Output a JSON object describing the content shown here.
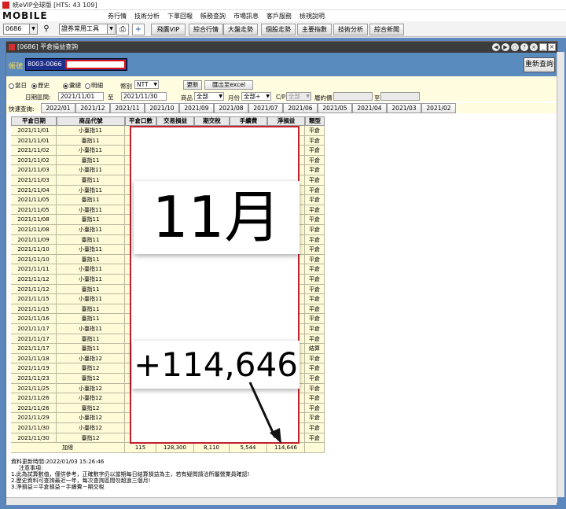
{
  "titlebar": {
    "title": "統eVIP全球版 [HTS: 43 109]"
  },
  "menubar": {
    "logo": "MOBILE",
    "items": [
      "券行情",
      "技術分析",
      "下單回報",
      "帳務查詢",
      "市場訊息",
      "客戶服務",
      "檢視說明"
    ]
  },
  "toolbar": {
    "code_value": "0686",
    "tool_select": "證券常用工具",
    "buttons": [
      "飛鷹VIP",
      "綜合行情",
      "大盤走勢",
      "個股走勢",
      "主要指數",
      "技術分析",
      "綜合新聞"
    ]
  },
  "window": {
    "title": "[0686] 平倉損益查詢",
    "controls": [
      "◀",
      "▶",
      "○",
      "?",
      "×"
    ],
    "minimize": "_",
    "maximize": "□",
    "close": "×"
  },
  "account": {
    "label": "帳號",
    "value": "8003-0066",
    "requery_label": "重新查詢"
  },
  "filter": {
    "radio_today": "當日",
    "radio_history": "歷史",
    "radio_summary": "彙總",
    "radio_detail": "明細",
    "currency_label": "幣別",
    "currency_value": "NTT",
    "refresh_label": "更新",
    "export_label": "匯出至excel",
    "date_label": "日期區間:",
    "date_from": "2021/11/01",
    "date_to_label": "至",
    "date_to": "2021/11/30",
    "product_label": "商品",
    "product_value": "全部",
    "month_label": "月份",
    "month_value": "全部+",
    "cp_label": "C/P",
    "cp_value": "全部",
    "strike_label": "履約價",
    "strike_to_label": "至"
  },
  "quick": {
    "label": "快速查詢:",
    "tabs": [
      "2022/01",
      "2021/12",
      "2021/11",
      "2021/10",
      "2021/09",
      "2021/08",
      "2021/07",
      "2021/06",
      "2021/05",
      "2021/04",
      "2021/03",
      "2021/02"
    ]
  },
  "table": {
    "headers": [
      "平倉日期",
      "商品代號",
      "平倉口數",
      "交易損益",
      "期交稅",
      "手續費",
      "淨損益",
      "類型"
    ],
    "rows": [
      [
        "2021/11/01",
        "小臺指11",
        "平倉"
      ],
      [
        "2021/11/01",
        "臺指11",
        "平倉"
      ],
      [
        "2021/11/02",
        "小臺指11",
        "平倉"
      ],
      [
        "2021/11/02",
        "臺指11",
        "平倉"
      ],
      [
        "2021/11/03",
        "小臺指11",
        "平倉"
      ],
      [
        "2021/11/03",
        "臺指11",
        "平倉"
      ],
      [
        "2021/11/04",
        "小臺指11",
        "平倉"
      ],
      [
        "2021/11/05",
        "臺指11",
        "平倉"
      ],
      [
        "2021/11/05",
        "小臺指11",
        "平倉"
      ],
      [
        "2021/11/08",
        "臺指11",
        "平倉"
      ],
      [
        "2021/11/08",
        "小臺指11",
        "平倉"
      ],
      [
        "2021/11/09",
        "臺指11",
        "平倉"
      ],
      [
        "2021/11/10",
        "小臺指11",
        "平倉"
      ],
      [
        "2021/11/10",
        "臺指11",
        "平倉"
      ],
      [
        "2021/11/11",
        "小臺指11",
        "平倉"
      ],
      [
        "2021/11/12",
        "小臺指11",
        "平倉"
      ],
      [
        "2021/11/12",
        "臺指11",
        "平倉"
      ],
      [
        "2021/11/15",
        "小臺指11",
        "平倉"
      ],
      [
        "2021/11/15",
        "臺指11",
        "平倉"
      ],
      [
        "2021/11/16",
        "臺指11",
        "平倉"
      ],
      [
        "2021/11/17",
        "小臺指11",
        "平倉"
      ],
      [
        "2021/11/17",
        "臺指11",
        "平倉"
      ],
      [
        "2021/11/17",
        "臺指11",
        "結算"
      ],
      [
        "2021/11/18",
        "小臺指12",
        "平倉"
      ],
      [
        "2021/11/19",
        "臺指12",
        "平倉"
      ],
      [
        "2021/11/23",
        "臺指12",
        "平倉"
      ],
      [
        "2021/11/25",
        "小臺指12",
        "平倉"
      ],
      [
        "2021/11/26",
        "小臺指12",
        "平倉"
      ],
      [
        "2021/11/26",
        "臺指12",
        "平倉"
      ],
      [
        "2021/11/29",
        "小臺指12",
        "平倉"
      ],
      [
        "2021/11/30",
        "小臺指12",
        "平倉"
      ],
      [
        "2021/11/30",
        "臺指12",
        "平倉"
      ]
    ],
    "total": {
      "label": "加總",
      "lots": "115",
      "trade_pnl": "128,300",
      "tax": "8,110",
      "fee": "5,544",
      "net": "114,646"
    }
  },
  "overlay": {
    "month_text": "11月",
    "net_text": "+114,646"
  },
  "notes": {
    "update_time": "資料更新時間:2022/01/03 15:26:46",
    "title": "注意事項:",
    "lines": [
      "1.此為試算數值，僅供參考，正確數字仍以當期每日結算損益為主，若有疑問請洽所屬營業員確認!",
      "2.歷史資料可查詢最近一年，每次查詢區間勿超過三個月!",
      "3.淨損益＝平倉損益－手續費－期交稅"
    ]
  }
}
